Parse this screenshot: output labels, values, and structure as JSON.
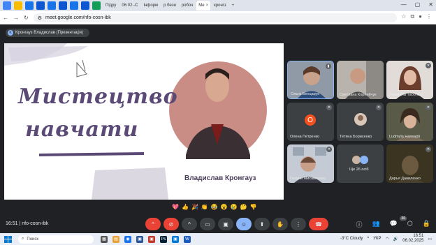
{
  "browser": {
    "tabs": [
      {
        "label": "Підру",
        "active": false
      },
      {
        "label": "06.02.-С",
        "active": false
      },
      {
        "label": "Інформ",
        "active": false
      },
      {
        "label": "р бези",
        "active": false
      },
      {
        "label": "робоч",
        "active": false
      },
      {
        "label": "Мe",
        "active": true
      },
      {
        "label": "кронгз",
        "active": false
      }
    ],
    "close_mark": "×",
    "new_tab": "+",
    "url": "meet.google.com/nfo-cosn-ibk"
  },
  "meet": {
    "presenter_chip": "K",
    "presenter_label": "Кронгауз Владислав (Презентація)",
    "slide": {
      "title_line1": "Мистецтво",
      "title_line2": "навчати",
      "person_name": "Владислав Кронгауз"
    },
    "participants": [
      {
        "name": "Ольга Бенцарук",
        "kind": "video"
      },
      {
        "name": "Светлана Корнейчук",
        "kind": "video"
      },
      {
        "name": "Людмила Таболіна",
        "kind": "video"
      },
      {
        "name": "Олена Петренко",
        "kind": "avatar",
        "initial": "О"
      },
      {
        "name": "Тетяна Борисенко",
        "kind": "avatar-photo"
      },
      {
        "name": "Ludmyla Hannadii",
        "kind": "video"
      },
      {
        "name": "Галина Михайленко",
        "kind": "video"
      },
      {
        "name": "Ще 26 осіб",
        "kind": "more"
      },
      {
        "name": "Дарья Даниленко",
        "kind": "video"
      }
    ],
    "reactions": [
      "💖",
      "👍",
      "🎉",
      "👏",
      "😂",
      "😮",
      "😢",
      "🤔",
      "👎"
    ],
    "time": "16:51",
    "meeting_code": "nfo-cosn-ibk",
    "people_count": "36"
  },
  "taskbar": {
    "search_placeholder": "Поиск",
    "weather": "-3°C  Cloudy",
    "lang": "УКР",
    "time": "16:51",
    "date": "06.02.2025"
  },
  "colors": {
    "meet_bg": "#202124",
    "hangup": "#ea4335",
    "slide_accent": "#5b4a76"
  }
}
